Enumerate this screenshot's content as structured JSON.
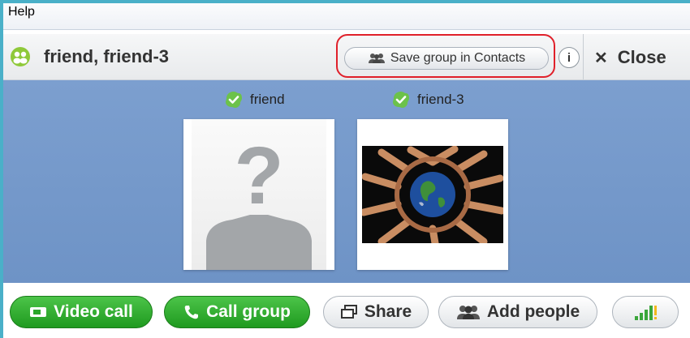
{
  "menu": {
    "items": [
      "Help"
    ]
  },
  "header": {
    "title": "friend, friend-3",
    "save_group_label": "Save group in Contacts",
    "info_label": "i",
    "close_label": "Close"
  },
  "participants": [
    {
      "name": "friend",
      "avatar": "unknown-avatar"
    },
    {
      "name": "friend-3",
      "avatar": "photo-hands-globe"
    }
  ],
  "toolbar": {
    "video_call": "Video call",
    "call_group": "Call group",
    "share": "Share",
    "add_people": "Add people"
  },
  "colors": {
    "accent_green": "#2aa62a",
    "highlight_red": "#e0202a",
    "participant_bg": "#7399cb"
  },
  "icons": [
    "group-icon",
    "contacts-icon",
    "info-icon",
    "close-icon",
    "online-status-icon",
    "video-icon",
    "phone-icon",
    "share-screen-icon",
    "add-people-icon",
    "signal-strength-icon"
  ]
}
